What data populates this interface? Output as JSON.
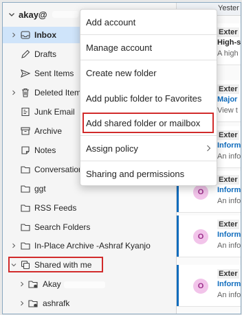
{
  "account": {
    "name": "akay@",
    "redacted": true
  },
  "folders": [
    {
      "label": "Inbox",
      "icon": "inbox-icon",
      "expandable": true,
      "selected": true
    },
    {
      "label": "Drafts",
      "icon": "pencil-icon",
      "expandable": false
    },
    {
      "label": "Sent Items",
      "icon": "send-icon",
      "expandable": false
    },
    {
      "label": "Deleted Item",
      "icon": "trash-icon",
      "expandable": true
    },
    {
      "label": "Junk Email",
      "icon": "junk-icon",
      "expandable": false
    },
    {
      "label": "Archive",
      "icon": "archive-icon",
      "expandable": false
    },
    {
      "label": "Notes",
      "icon": "note-icon",
      "expandable": false
    },
    {
      "label": "Conversation",
      "icon": "folder-icon",
      "expandable": false
    },
    {
      "label": "ggt",
      "icon": "folder-icon",
      "expandable": false
    },
    {
      "label": "RSS Feeds",
      "icon": "folder-icon",
      "expandable": false
    },
    {
      "label": "Search Folders",
      "icon": "folder-icon",
      "expandable": false
    },
    {
      "label": "In-Place Archive -Ashraf Kyanjo",
      "icon": "folder-icon",
      "expandable": true
    },
    {
      "label": "Shared with me",
      "icon": "shared-icon",
      "expandable": true,
      "expanded": true,
      "highlighted": true
    }
  ],
  "shared_items": [
    {
      "label": "Akay",
      "icon": "shared-folder-icon",
      "redacted": true
    },
    {
      "label": "ashrafk",
      "icon": "shared-folder-icon"
    }
  ],
  "message_list": {
    "top_label": "Yester",
    "messages": [
      {
        "sender": "Exter",
        "subject": "High-s",
        "preview": "A high",
        "avatar": "",
        "bar": false
      },
      {
        "sender": "Exter",
        "subject": "Major",
        "preview": "View t",
        "avatar": "",
        "bar": false
      },
      {
        "sender": "Exter",
        "subject": "Inform",
        "preview": "An info",
        "avatar": "",
        "bar": true
      },
      {
        "sender": "Exter",
        "subject": "Inform",
        "preview": "An info",
        "avatar": "O",
        "bar": true
      },
      {
        "sender": "Exter",
        "subject": "Inform",
        "preview": "An info",
        "avatar": "O",
        "bar": true
      },
      {
        "sender": "Exter",
        "subject": "Inform",
        "preview": "An info",
        "avatar": "O",
        "bar": true
      }
    ]
  },
  "context_menu": {
    "items": [
      {
        "label": "Add account"
      },
      {
        "label": "Manage account"
      },
      {
        "label": "Create new folder"
      },
      {
        "label": "Add public folder to Favorites"
      },
      {
        "label": "Add shared folder or mailbox",
        "highlighted": true
      },
      {
        "label": "Assign policy",
        "submenu": true
      },
      {
        "label": "Sharing and permissions"
      }
    ]
  },
  "colors": {
    "accent": "#0f6cbd",
    "highlight_box": "#d12a2a",
    "selected_bg": "#cfe4fa",
    "avatar_bg": "#f2c4ea"
  }
}
